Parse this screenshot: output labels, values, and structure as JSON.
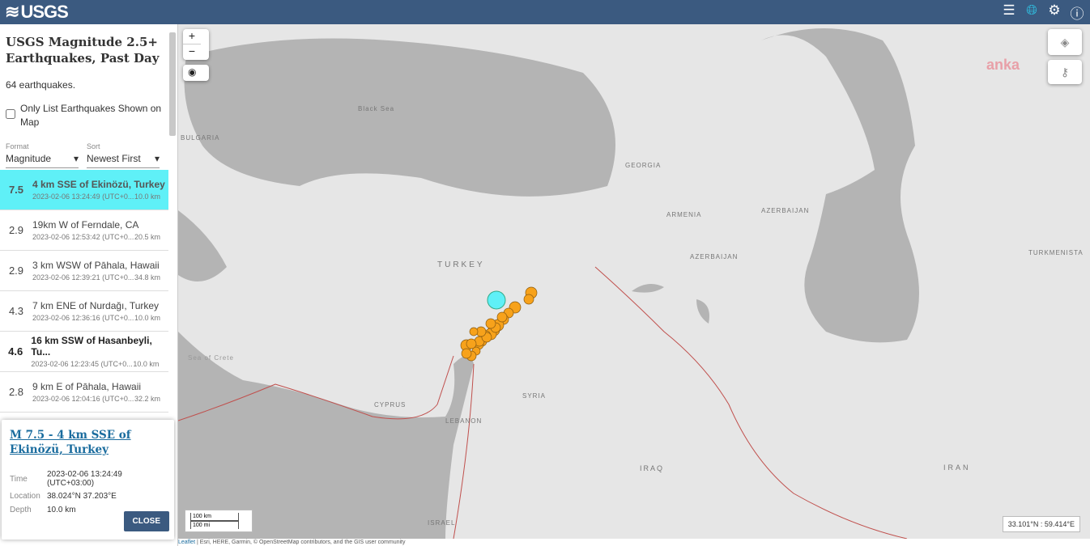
{
  "header": {
    "logo": "USGS",
    "icons": [
      "list-icon",
      "globe-icon",
      "gear-icon",
      "help-icon"
    ]
  },
  "sidebar": {
    "title": "USGS Magnitude 2.5+ Earthquakes, Past Day",
    "count": "64 earthquakes.",
    "only_list_label": "Only List Earthquakes Shown on Map",
    "only_list_checked": false,
    "format": {
      "label": "Format",
      "value": "Magnitude"
    },
    "sort": {
      "label": "Sort",
      "value": "Newest First"
    },
    "items": [
      {
        "mag": "7.5",
        "place": "4 km SSE of Ekinözü, Turkey",
        "time": "2023-02-06 13:24:49 (UTC+0...",
        "depth": "10.0 km",
        "selected": true
      },
      {
        "mag": "2.9",
        "place": "19km W of Ferndale, CA",
        "time": "2023-02-06 12:53:42 (UTC+0...",
        "depth": "20.5 km"
      },
      {
        "mag": "2.9",
        "place": "3 km WSW of Pāhala, Hawaii",
        "time": "2023-02-06 12:39:21 (UTC+0...",
        "depth": "34.8 km"
      },
      {
        "mag": "4.3",
        "place": "7 km ENE of Nurdağı, Turkey",
        "time": "2023-02-06 12:36:16 (UTC+0...",
        "depth": "10.0 km"
      },
      {
        "mag": "4.6",
        "place": "16 km SSW of Hasanbeyli, Tu...",
        "time": "2023-02-06 12:23:45 (UTC+0...",
        "depth": "10.0 km",
        "bold": true
      },
      {
        "mag": "2.8",
        "place": "9 km E of Pāhala, Hawaii",
        "time": "2023-02-06 12:04:16 (UTC+0...",
        "depth": "32.2 km"
      }
    ]
  },
  "popup": {
    "title": "M 7.5 - 4 km SSE of Ekinözü, Turkey",
    "time_label": "Time",
    "time": "2023-02-06 13:24:49 (UTC+03:00)",
    "location_label": "Location",
    "location": "38.024°N 37.203°E",
    "depth_label": "Depth",
    "depth": "10.0 km",
    "close": "CLOSE"
  },
  "map": {
    "zoom_in": "+",
    "zoom_out": "−",
    "labels": {
      "black_sea": "Black Sea",
      "bulgaria": "BULGARIA",
      "georgia": "GEORGIA",
      "armenia": "ARMENIA",
      "azerbaijan1": "AZERBAIJAN",
      "azerbaijan2": "AZERBAIJAN",
      "turkmenistan": "TURKMENISTA",
      "turkey": "TURKEY",
      "syria": "SYRIA",
      "cyprus": "CYPRUS",
      "lebanon": "LEBANON",
      "iraq": "IRAQ",
      "iran": "IRAN",
      "israel": "ISRAEL",
      "crete": "Sea of Crete"
    },
    "watermark": "anka",
    "scale_km": "100 km",
    "scale_mi": "100 mi",
    "coords": "33.101°N : 59.414°E",
    "attribution_leaflet": "Leaflet",
    "attribution": " | Esri, HERE, Garmin, © OpenStreetMap contributors, and the GIS user community",
    "colors": {
      "selected": "#5ff0f7",
      "quake": "#f7a21b",
      "water": "#b4b4b4",
      "land": "#e6e6e6",
      "plate": "#c0504d"
    }
  }
}
